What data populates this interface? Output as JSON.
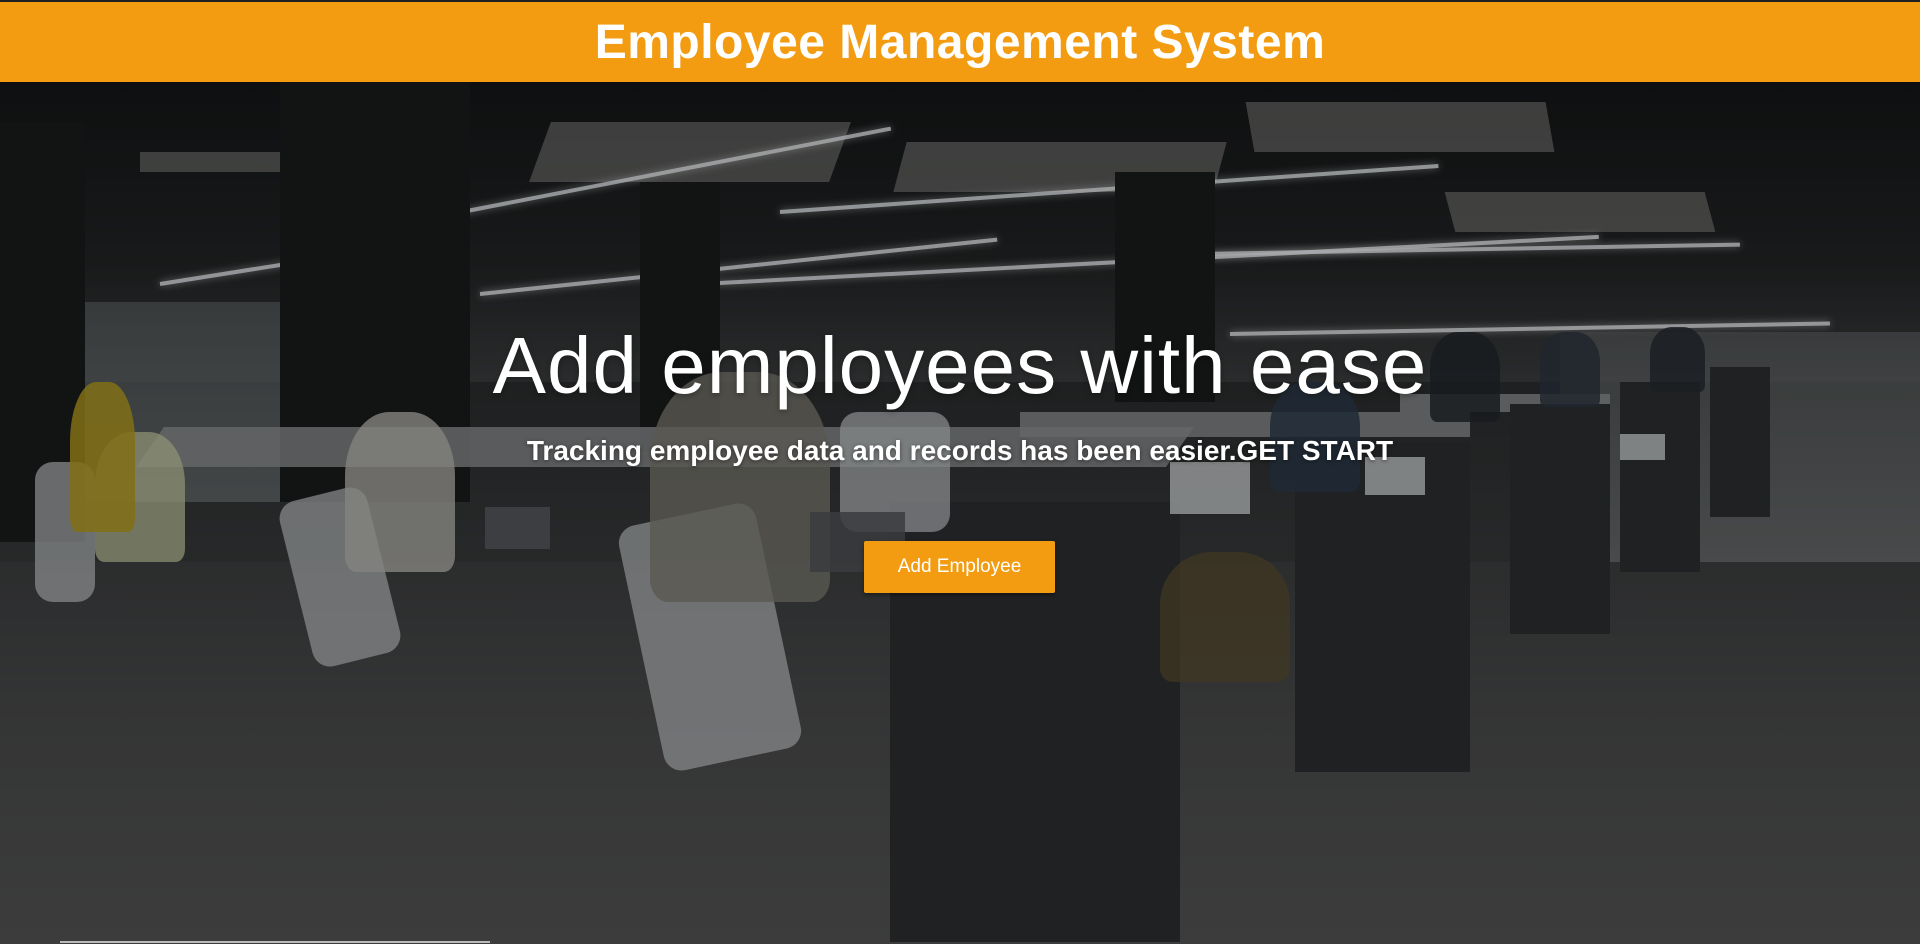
{
  "header": {
    "title": "Employee Management System"
  },
  "hero": {
    "heading": "Add employees with ease",
    "subheading": "Tracking employee data and records has been easier.GET START",
    "cta_label": "Add Employee"
  },
  "colors": {
    "accent": "#f39c12",
    "text": "#ffffff"
  }
}
